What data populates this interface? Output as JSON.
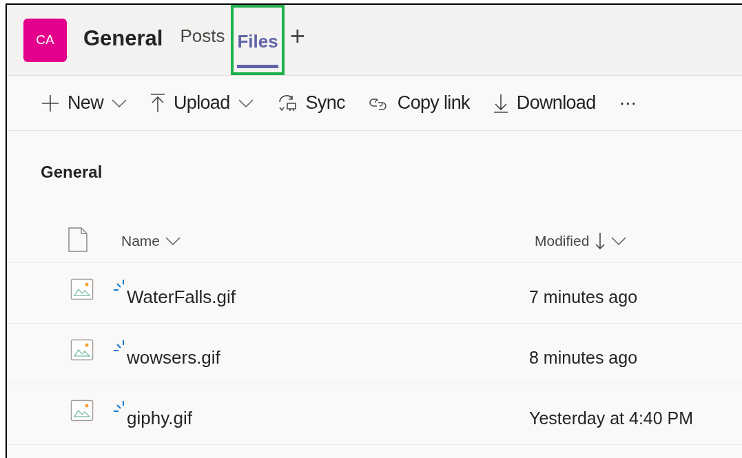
{
  "header": {
    "avatar": "CA",
    "title": "General",
    "tabs": [
      {
        "label": "Posts",
        "selected": false,
        "highlighted": false
      },
      {
        "label": "Files",
        "selected": true,
        "highlighted": true
      }
    ],
    "add_tab": "+"
  },
  "toolbar": [
    {
      "kind": "new",
      "label": "New",
      "dropdown": true
    },
    {
      "kind": "upload",
      "label": "Upload",
      "dropdown": true
    },
    {
      "kind": "sync",
      "label": "Sync",
      "dropdown": false
    },
    {
      "kind": "link",
      "label": "Copy link",
      "dropdown": false
    },
    {
      "kind": "download",
      "label": "Download",
      "dropdown": false
    },
    {
      "kind": "more",
      "label": "···",
      "dropdown": false
    }
  ],
  "section_title": "General",
  "table": {
    "columns": [
      {
        "label": "Name",
        "sorted_down": false
      },
      {
        "label": "Modified",
        "sorted_down": true
      }
    ],
    "rows": [
      {
        "name": "WaterFalls.gif",
        "modified": "7 minutes ago",
        "new": true
      },
      {
        "name": "wowsers.gif",
        "modified": "8 minutes ago",
        "new": true
      },
      {
        "name": "giphy.gif",
        "modified": "Yesterday at 4:40 PM",
        "new": true
      }
    ]
  }
}
